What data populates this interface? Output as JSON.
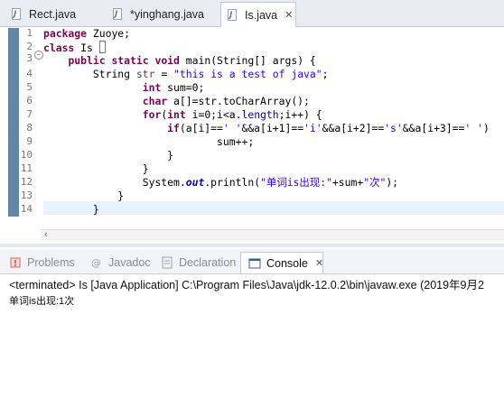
{
  "editor_tabs": [
    {
      "label": "Rect.java",
      "active": false
    },
    {
      "label": "*yinghang.java",
      "active": false
    },
    {
      "label": "Is.java",
      "active": true,
      "close": "✕"
    }
  ],
  "line_numbers": [
    "1",
    "2",
    "3",
    "4",
    "5",
    "6",
    "7",
    "8",
    "9",
    "10",
    "11",
    "12",
    "13",
    "14"
  ],
  "fold_marker": "−",
  "code": {
    "l1_kw": "package",
    "l1_rest": " Zuoye;",
    "l2_kw": "class",
    "l2_rest": " Is ",
    "l3_indent": "    ",
    "l3_kw1": "public",
    "l3_kw2": "static",
    "l3_kw3": "void",
    "l3_rest": " main(String[] args) {",
    "l4_indent": "        ",
    "l4_type": "String ",
    "l4_var": "str",
    "l4_eq": " = ",
    "l4_str": "\"this is a test of java\"",
    "l4_end": ";",
    "l5_indent": "                ",
    "l5_kw": "int",
    "l5_rest": " sum=0;",
    "l6_indent": "                ",
    "l6_kw": "char",
    "l6_rest": " a[]=str.toCharArray();",
    "l7_indent": "                ",
    "l7_kw": "for",
    "l7_a": "(",
    "l7_kw2": "int",
    "l7_rest": " i=0;i<a.",
    "l7_fld": "length",
    "l7_end": ";i++) {",
    "l8_indent": "                    ",
    "l8_kw": "if",
    "l8_a": "(a[i]==",
    "l8_s1": "' '",
    "l8_b": "&&a[i+1]==",
    "l8_s2": "'i'",
    "l8_c": "&&a[i+2]==",
    "l8_s3": "'s'",
    "l8_d": "&&a[i+3]==",
    "l8_s4": "' '",
    "l8_e": ")",
    "l9_indent": "                            ",
    "l9_rest": "sum++;",
    "l10_indent": "                    ",
    "l10_rest": "}",
    "l11_indent": "                ",
    "l11_rest": "}",
    "l12_indent": "                ",
    "l12_a": "System.",
    "l12_fld": "out",
    "l12_b": ".println(",
    "l12_s1": "\"单词is出现:\"",
    "l12_c": "+sum+",
    "l12_s2": "\"次\"",
    "l12_end": ");",
    "l13_indent": "            ",
    "l13_rest": "}",
    "l14_indent": "        ",
    "l14_rest": "}"
  },
  "view_tabs": [
    {
      "label": "Problems",
      "icon": "problems-icon"
    },
    {
      "label": "Javadoc",
      "icon": "javadoc-icon"
    },
    {
      "label": "Declaration",
      "icon": "declaration-icon"
    },
    {
      "label": "Console",
      "icon": "console-icon",
      "active": true,
      "close": "✕"
    }
  ],
  "console": {
    "status": "<terminated> Is [Java Application] C:\\Program Files\\Java\\jdk-12.0.2\\bin\\javaw.exe (2019年9月2",
    "output": "单词is出现:1次"
  },
  "colors": {
    "keyword": "#7f0055",
    "string": "#2a00ff",
    "field": "#0000c0",
    "ruler": "#5e88a8"
  }
}
